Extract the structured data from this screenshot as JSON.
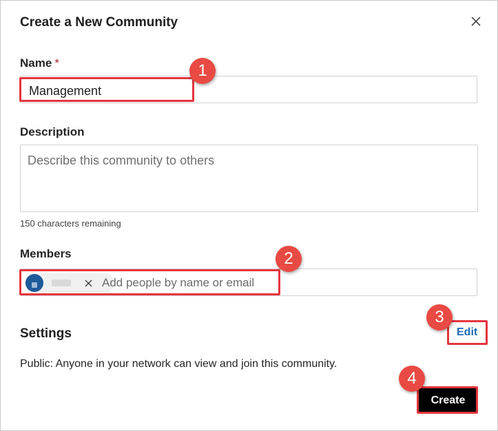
{
  "dialog": {
    "title": "Create a New Community",
    "close_icon": "close-icon"
  },
  "name": {
    "label": "Name",
    "required_mark": "*",
    "value": "Management"
  },
  "description": {
    "label": "Description",
    "placeholder": "Describe this community to others",
    "value": "",
    "helper": "150 characters remaining"
  },
  "members": {
    "label": "Members",
    "placeholder": "Add people by name or email",
    "chips": [
      {
        "icon": "person-avatar-icon",
        "remove_icon": "close-icon"
      }
    ]
  },
  "settings": {
    "title": "Settings",
    "edit_label": "Edit",
    "visibility_text": "Public: Anyone in your network can view and join this community."
  },
  "actions": {
    "create_label": "Create"
  },
  "annotations": {
    "color": "#e5353d",
    "steps": [
      "1",
      "2",
      "3",
      "4"
    ]
  }
}
